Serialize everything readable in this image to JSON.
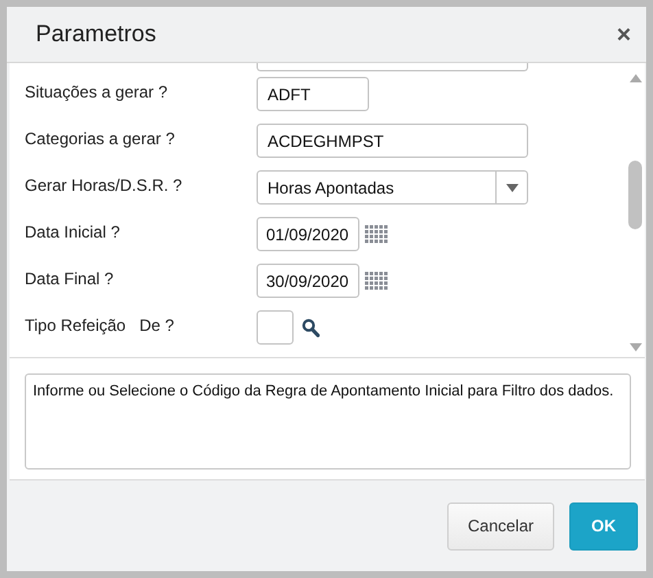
{
  "window": {
    "title": "Parametros",
    "close": "×"
  },
  "fields": [
    {
      "kind": "partial"
    },
    {
      "kind": "short_text",
      "label": "Situações a gerar ?",
      "value": "ADFT"
    },
    {
      "kind": "long_text",
      "label": "Categorias a gerar ?",
      "value": "ACDEGHMPST"
    },
    {
      "kind": "select",
      "label": "Gerar Horas/D.S.R. ?",
      "value": "Horas Apontadas"
    },
    {
      "kind": "date",
      "label": "Data Inicial ?",
      "value": "01/09/2020"
    },
    {
      "kind": "date",
      "label": "Data Final ?",
      "value": "30/09/2020"
    },
    {
      "kind": "lookup",
      "label": "Tipo Refeição",
      "label_2": "De ?"
    }
  ],
  "help": "Informe ou Selecione o Código da Regra de Apontamento Inicial para Filtro dos dados.",
  "buttons": [
    {
      "label": "Cancelar",
      "kind": "secondary"
    },
    {
      "label": "OK",
      "kind": "primary"
    }
  ]
}
